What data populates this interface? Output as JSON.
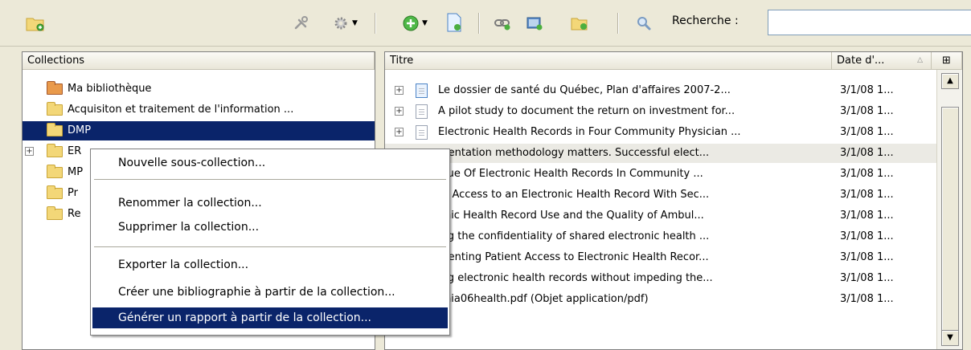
{
  "toolbar": {
    "new_collection_icon": "folder-add-icon",
    "link_icon": "link-icon",
    "actions_icon": "gear-icon",
    "new_item_icon": "green-plus-icon",
    "new_note_icon": "document-icon",
    "search_label": "Recherche :",
    "search_value": ""
  },
  "collections": {
    "header": "Collections",
    "items": [
      {
        "label": "Ma bibliothèque"
      },
      {
        "label": "Acquisiton et traitement de l'information ..."
      },
      {
        "label": "DMP"
      },
      {
        "label": "ER"
      },
      {
        "label": "MP"
      },
      {
        "label": "Pr"
      },
      {
        "label": "Re"
      }
    ]
  },
  "items": {
    "header_title": "Titre",
    "header_date": "Date d'...",
    "rows": [
      {
        "title": "Le dossier de santé du Québec, Plan d'affaires 2007-2...",
        "date": "3/1/08 1..."
      },
      {
        "title": "A pilot study to document the return on investment for...",
        "date": "3/1/08 1..."
      },
      {
        "title": "Electronic Health Records in Four Community Physician ...",
        "date": "3/1/08 1..."
      },
      {
        "title": "mentation methodology matters. Successful elect...",
        "date": "3/1/08 1..."
      },
      {
        "title": "alue Of Electronic Health Records In Community ...",
        "date": "3/1/08 1..."
      },
      {
        "title": "nt Access to an Electronic Health Record With Sec...",
        "date": "3/1/08 1..."
      },
      {
        "title": "onic Health Record Use and the Quality of Ambul...",
        "date": "3/1/08 1..."
      },
      {
        "title": "ing the confidentiality of shared electronic health ...",
        "date": "3/1/08 1..."
      },
      {
        "title": "menting Patient Access to Electronic Health Recor...",
        "date": "3/1/08 1..."
      },
      {
        "title": "ing electronic health records without impeding the...",
        "date": "3/1/08 1..."
      },
      {
        "title": "jmia06health.pdf (Objet application/pdf)",
        "date": "3/1/08 1..."
      }
    ]
  },
  "context_menu": {
    "new_subcollection": "Nouvelle sous-collection...",
    "rename": "Renommer la collection...",
    "delete": "Supprimer la collection...",
    "export": "Exporter la collection...",
    "bibliography": "Créer une bibliographie à partir de la collection...",
    "report": "Générer un rapport à partir de la collection..."
  }
}
